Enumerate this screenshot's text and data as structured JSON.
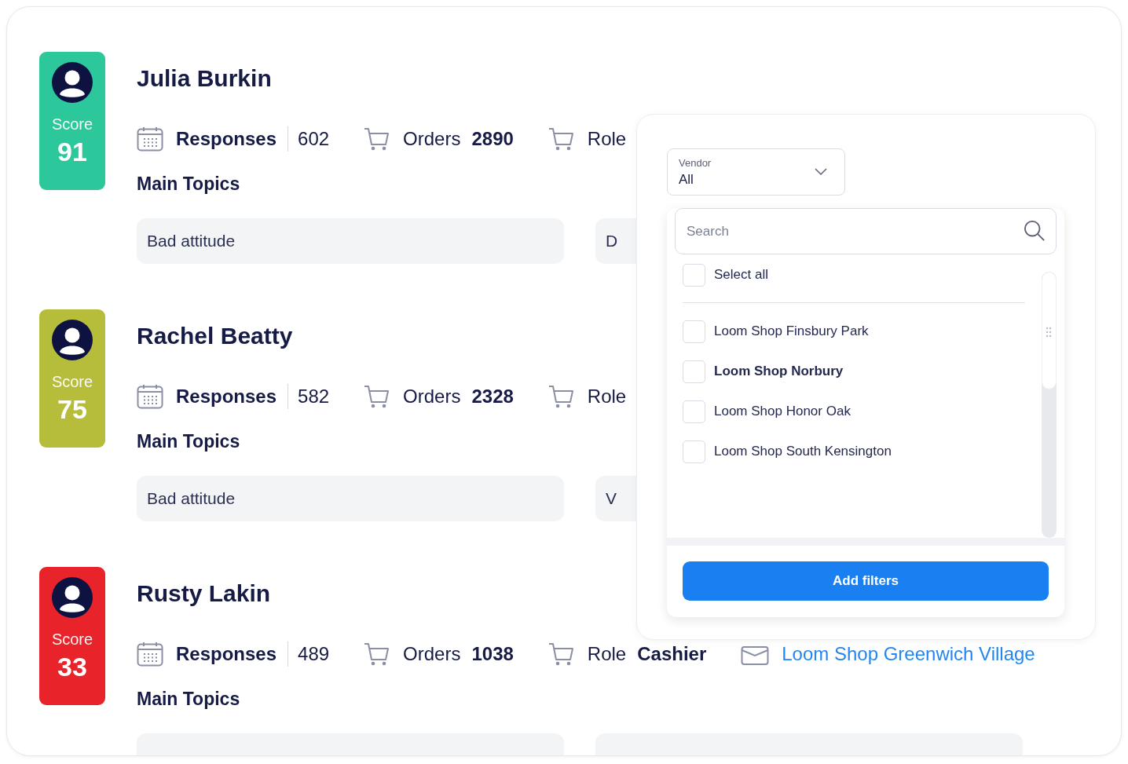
{
  "people": [
    {
      "name": "Julia Burkin",
      "score_label": "Score",
      "score": "91",
      "color": "#2cc79b",
      "responses_label": "Responses",
      "responses": "602",
      "orders_label": "Orders",
      "orders": "2890",
      "role_label": "Role",
      "topics_label": "Main Topics",
      "topics": [
        "Bad attitude",
        "D"
      ]
    },
    {
      "name": "Rachel Beatty",
      "score_label": "Score",
      "score": "75",
      "color": "#b5bd3b",
      "responses_label": "Responses",
      "responses": "582",
      "orders_label": "Orders",
      "orders": "2328",
      "role_label": "Role",
      "topics_label": "Main Topics",
      "topics": [
        "Bad attitude",
        "V"
      ]
    },
    {
      "name": "Rusty Lakin",
      "score_label": "Score",
      "score": "33",
      "color": "#e8232a",
      "responses_label": "Responses",
      "responses": "489",
      "orders_label": "Orders",
      "orders": "1038",
      "role_label": "Role",
      "role": "Cashier",
      "store": "Loom Shop Greenwich Village",
      "topics_label": "Main Topics"
    }
  ],
  "filter": {
    "vendor_label": "Vendor",
    "vendor_value": "All",
    "search_placeholder": "Search",
    "select_all": {
      "label": "Select all",
      "checked": false
    },
    "options": [
      {
        "label": "Loom Shop Finsbury Park",
        "checked": false,
        "highlighted": false
      },
      {
        "label": "Loom Shop Norbury",
        "checked": false,
        "highlighted": true
      },
      {
        "label": "Loom Shop Honor Oak",
        "checked": false,
        "highlighted": false
      },
      {
        "label": "Loom Shop South Kensington",
        "checked": false,
        "highlighted": false
      }
    ],
    "button": "Add filters"
  }
}
